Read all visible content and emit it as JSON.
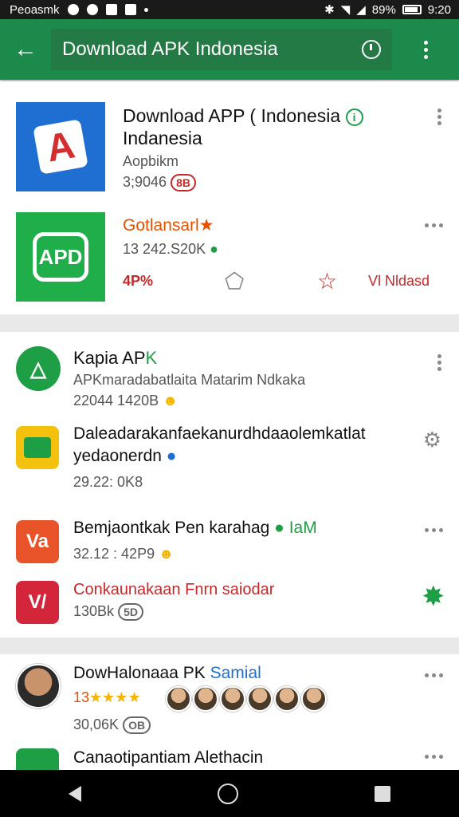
{
  "status_bar": {
    "carrier": "Peoasmk",
    "battery": "89%",
    "time": "9:20"
  },
  "app_bar": {
    "back_icon": "arrow-left-icon",
    "search_text": "Download APK Indonesia",
    "history_icon": "clock-icon",
    "more_icon": "more-vert-icon"
  },
  "card1": {
    "app1": {
      "title_line1": "Download APP ( Indonesia",
      "title_line2": "Indanesia",
      "developer": "Aopbikm",
      "stats": "3;9046",
      "badge": "8B"
    },
    "app2": {
      "title": "Gotlansarl★",
      "stats": "13 242.S20K",
      "size": "4P%",
      "action_label": "Vl Nldasd",
      "icon_text": "APD"
    }
  },
  "card2": {
    "item1": {
      "title_plain": "Kapia AP",
      "title_green": "K",
      "desc": "APKmaradabatlaita Matarim Ndkaka",
      "stats": "22044 1420B"
    },
    "item2": {
      "title_line1": "Daleadarakanfaekanurdhdaaolemkatlat",
      "title_line2": "yedaonerdn",
      "stats": "29.22:  0K8"
    },
    "item3": {
      "title": "Bemjaontkak Pen karahag",
      "tag": "IaM",
      "stats": "32.12 : 42P9",
      "icon_text": "Va"
    },
    "item4": {
      "title": "Conkaunakaan Fnrn saiodar",
      "stats": "130Bk",
      "badge": "5D",
      "icon_text": "V/"
    }
  },
  "card3": {
    "item1": {
      "title": "DowHalonaaa PK",
      "title_blue": "Samial",
      "rating_prefix": "13",
      "stars": "★★★★",
      "stats": "30,06K",
      "badge": "OB"
    },
    "item2": {
      "title": "Canaotipantiam Alethacin"
    }
  },
  "colors": {
    "app_bar": "#1b8a4a",
    "accent_green": "#1e9e45",
    "accent_red": "#c62828",
    "accent_orange": "#e65100"
  }
}
